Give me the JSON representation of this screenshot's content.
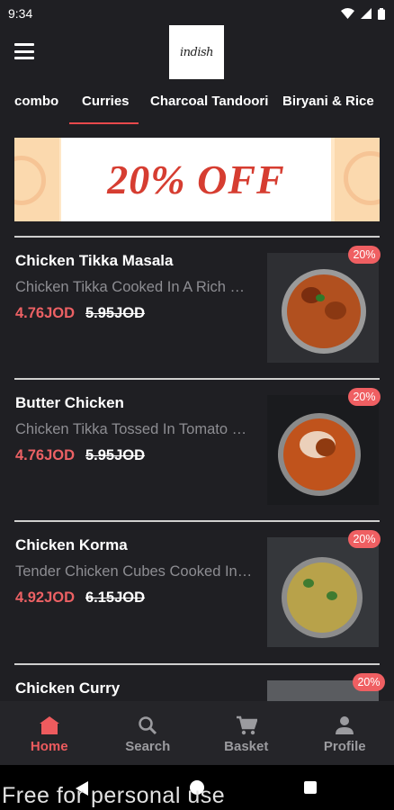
{
  "status_bar": {
    "time": "9:34"
  },
  "logo": {
    "text": "indish"
  },
  "tabs": [
    {
      "label": "combo"
    },
    {
      "label": "Curries"
    },
    {
      "label": "Charcoal Tandoori"
    },
    {
      "label": "Biryani & Rice"
    }
  ],
  "active_tab": "Curries",
  "banner": {
    "text": "20% OFF"
  },
  "items": [
    {
      "name": "Chicken Tikka Masala",
      "description": "Chicken Tikka Cooked In A Rich …",
      "price": "4.76JOD",
      "old_price": "5.95JOD",
      "discount": "20%"
    },
    {
      "name": "Butter Chicken",
      "description": "Chicken Tikka Tossed In Tomato …",
      "price": "4.76JOD",
      "old_price": "5.95JOD",
      "discount": "20%"
    },
    {
      "name": "Chicken Korma",
      "description": "Tender Chicken Cubes Cooked In…",
      "price": "4.92JOD",
      "old_price": "6.15JOD",
      "discount": "20%"
    },
    {
      "name": "Chicken Curry",
      "discount": "20%"
    }
  ],
  "bottom_nav": [
    {
      "label": "Home",
      "icon": "home-icon"
    },
    {
      "label": "Search",
      "icon": "search-icon"
    },
    {
      "label": "Basket",
      "icon": "cart-icon"
    },
    {
      "label": "Profile",
      "icon": "person-icon"
    }
  ],
  "watermark": "Free for personal use",
  "colors": {
    "accent": "#ee5b5e",
    "background": "#1f1f23",
    "price": "#ec6164"
  }
}
